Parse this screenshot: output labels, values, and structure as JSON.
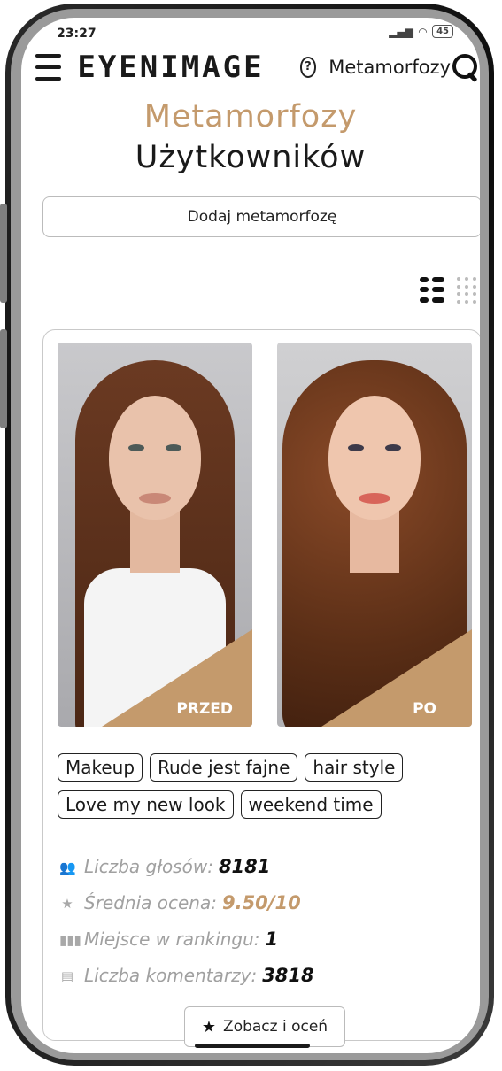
{
  "status": {
    "time": "23:27",
    "battery": "45"
  },
  "header": {
    "logo": "EYENIMAGE",
    "nav_label": "Metamorfozy"
  },
  "page": {
    "title_line1": "Metamorfozy",
    "title_line2": "Użytkowników",
    "add_button": "Dodaj metamorfozę"
  },
  "card": {
    "before_label": "PRZED",
    "after_label": "PO",
    "tags": [
      "Makeup",
      "Rude jest fajne",
      "hair style",
      "Love my new look",
      "weekend time"
    ],
    "stats": {
      "votes_label": "Liczba głosów:",
      "votes_value": "8181",
      "rating_label": "Średnia ocena:",
      "rating_value": "9.50/10",
      "rank_label": "Miejsce w rankingu:",
      "rank_value": "1",
      "comments_label": "Liczba komentarzy:",
      "comments_value": "3818"
    },
    "cta": "Zobacz i oceń"
  },
  "colors": {
    "accent": "#c49a6c",
    "text": "#1a1a1a",
    "muted": "#a0a0a0"
  },
  "icons": [
    "menu-icon",
    "help-icon",
    "search-icon",
    "list-view-icon",
    "grid-view-icon",
    "users-icon",
    "star-icon",
    "ranking-icon",
    "comment-icon"
  ]
}
